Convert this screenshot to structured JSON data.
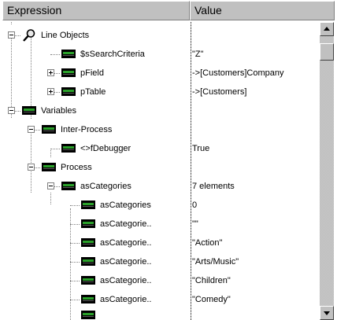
{
  "columns": {
    "expression": "Expression",
    "value": "Value"
  },
  "rows": [
    {
      "label": "Line Objects",
      "value": "",
      "icon": "magnifier-icon",
      "expander": "minus"
    },
    {
      "label": "$sSearchCriteria",
      "value": "\"Z\"",
      "icon": "variable-icon",
      "expander": ""
    },
    {
      "label": "pField",
      "value": "->[Customers]Company",
      "icon": "variable-icon",
      "expander": "plus"
    },
    {
      "label": "pTable",
      "value": "->[Customers]",
      "icon": "variable-icon",
      "expander": "plus"
    },
    {
      "label": "Variables",
      "value": "",
      "icon": "variable-icon",
      "expander": "minus"
    },
    {
      "label": "Inter-Process",
      "value": "",
      "icon": "variable-icon",
      "expander": "minus"
    },
    {
      "label": "<>fDebugger",
      "value": "True",
      "icon": "variable-icon",
      "expander": ""
    },
    {
      "label": "Process",
      "value": "",
      "icon": "variable-icon",
      "expander": "minus"
    },
    {
      "label": "asCategories",
      "value": "7 elements",
      "icon": "variable-icon",
      "expander": "minus"
    },
    {
      "label": "asCategories",
      "value": "0",
      "icon": "variable-icon",
      "expander": ""
    },
    {
      "label": "asCategorie..",
      "value": "\"\"",
      "icon": "variable-icon",
      "expander": ""
    },
    {
      "label": "asCategorie..",
      "value": "\"Action\"",
      "icon": "variable-icon",
      "expander": ""
    },
    {
      "label": "asCategorie..",
      "value": "\"Arts/Music\"",
      "icon": "variable-icon",
      "expander": ""
    },
    {
      "label": "asCategorie..",
      "value": "\"Children\"",
      "icon": "variable-icon",
      "expander": ""
    },
    {
      "label": "asCategorie..",
      "value": "\"Comedy\"",
      "icon": "variable-icon",
      "expander": ""
    }
  ],
  "colors": {
    "variable_icon_bar": "#2aa02a",
    "header_bg": "#c0c0c0"
  }
}
